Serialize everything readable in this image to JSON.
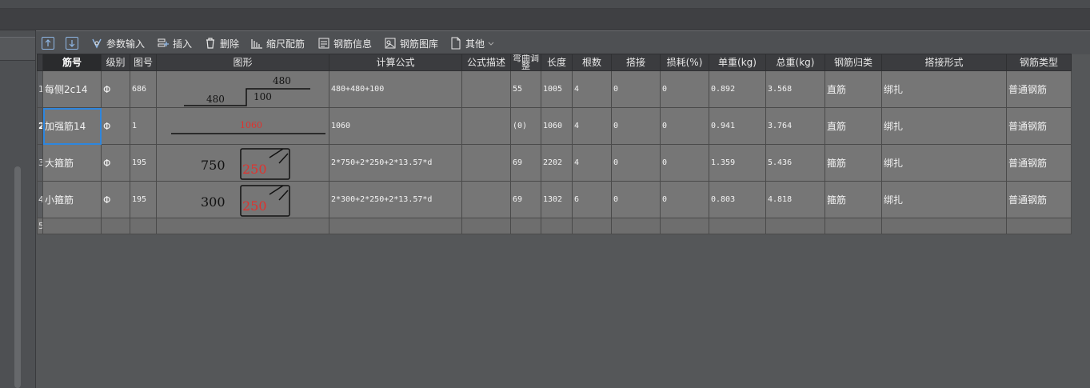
{
  "toolbar": {
    "up_label": "",
    "down_label": "",
    "param_input": "参数输入",
    "insert": "插入",
    "delete": "删除",
    "scale_rebar": "缩尺配筋",
    "rebar_info": "钢筋信息",
    "rebar_library": "钢筋图库",
    "other": "其他"
  },
  "table": {
    "headers": [
      "筋号",
      "级别",
      "图号",
      "图形",
      "计算公式",
      "公式描述",
      "弯曲调整",
      "长度",
      "根数",
      "搭接",
      "损耗(%)",
      "单重(kg)",
      "总重(kg)",
      "钢筋归类",
      "搭接形式",
      "钢筋类型"
    ],
    "rows": [
      {
        "no": "1",
        "name": "每侧2c14",
        "grade": "Φ",
        "fig": "686",
        "s1": "480",
        "s2": "480",
        "s3": "100",
        "formula": "480+480+100",
        "desc": "",
        "bend": "55",
        "length": "1005",
        "count": "4",
        "lap": "0",
        "loss": "0",
        "unit_w": "0.892",
        "total_w": "3.568",
        "category": "直筋",
        "lap_type": "绑扎",
        "rebar_type": "普通钢筋"
      },
      {
        "no": "2",
        "name": "加强筋14",
        "grade": "Φ",
        "fig": "1",
        "s1": "1060",
        "formula": "1060",
        "desc": "",
        "bend": "(0)",
        "length": "1060",
        "count": "4",
        "lap": "0",
        "loss": "0",
        "unit_w": "0.941",
        "total_w": "3.764",
        "category": "直筋",
        "lap_type": "绑扎",
        "rebar_type": "普通钢筋"
      },
      {
        "no": "3",
        "name": "大箍筋",
        "grade": "Φ",
        "fig": "195",
        "s1": "750",
        "s2": "250",
        "formula": "2*750+2*250+2*13.57*d",
        "desc": "",
        "bend": "69",
        "length": "2202",
        "count": "4",
        "lap": "0",
        "loss": "0",
        "unit_w": "1.359",
        "total_w": "5.436",
        "category": "箍筋",
        "lap_type": "绑扎",
        "rebar_type": "普通钢筋"
      },
      {
        "no": "4",
        "name": "小箍筋",
        "grade": "Φ",
        "fig": "195",
        "s1": "300",
        "s2": "250",
        "formula": "2*300+2*250+2*13.57*d",
        "desc": "",
        "bend": "69",
        "length": "1302",
        "count": "6",
        "lap": "0",
        "loss": "0",
        "unit_w": "0.803",
        "total_w": "4.818",
        "category": "箍筋",
        "lap_type": "绑扎",
        "rebar_type": "普通钢筋"
      }
    ],
    "empty_row_no": "5"
  },
  "colors": {
    "accent": "#2e86de",
    "dim_red": "#e0322e",
    "header_bg": "#3b3c3f",
    "cell_bg": "#767676"
  }
}
